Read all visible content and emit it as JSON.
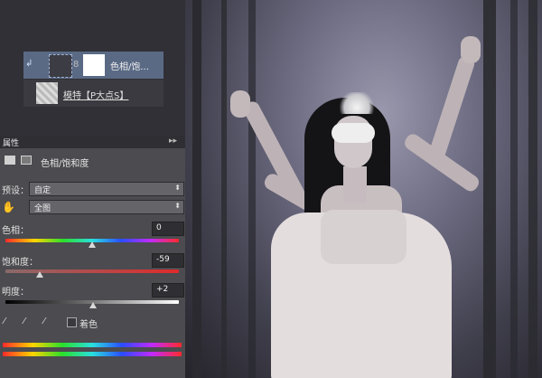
{
  "layers": {
    "adjustment_layer_name": "色相/饱...",
    "image_layer_name": "模特【P大点S】"
  },
  "properties": {
    "panel_title": "属性",
    "collapse_glyph": "▸▸",
    "adjustment_title": "色相/饱和度",
    "preset_label": "预设：",
    "preset_value": "自定",
    "channel_value": "全图",
    "hue_label": "色相：",
    "hue_value": "0",
    "saturation_label": "饱和度：",
    "saturation_value": "-59",
    "lightness_label": "明度：",
    "lightness_value": "+2",
    "colorize_label": "着色",
    "hand_glyph": "✋"
  },
  "colors": {
    "panel_bg": "#4b4b50",
    "selected_layer": "#5a6a85",
    "accent": "#9fb3d6"
  },
  "icons": [
    "visibility-icon",
    "adjustment-thumbnail-icon",
    "link-icon",
    "layer-mask-icon",
    "hue-saturation-icon",
    "mask-icon",
    "hand-tool-icon",
    "eyedropper-icon",
    "eyedropper-plus-icon",
    "eyedropper-minus-icon"
  ]
}
